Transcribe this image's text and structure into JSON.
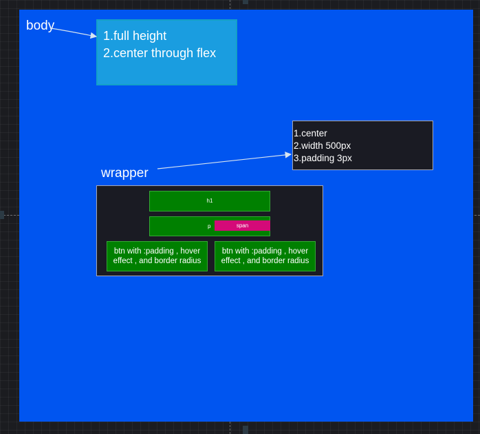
{
  "labels": {
    "body": "body",
    "wrapper": "wrapper"
  },
  "body_note": {
    "line1": "1.full height",
    "line2": "2.center through flex"
  },
  "wrapper_note": {
    "line1": "1.center",
    "line2": "2.width 500px",
    "line3": "3.padding 3px"
  },
  "wrapper_content": {
    "h1": "h1",
    "p": "p",
    "span": "span",
    "buttons": [
      {
        "line1": "btn with :padding , hover",
        "line2": "effect , and border radius"
      },
      {
        "line1": "btn with :padding , hover",
        "line2": "effect , and border radius"
      }
    ]
  },
  "colors": {
    "body_background": "#0055f0",
    "body_note_background": "#1a9de0",
    "element_green": "#008000",
    "span_pink": "#d40a78",
    "dark_box": "#1a1b23"
  }
}
